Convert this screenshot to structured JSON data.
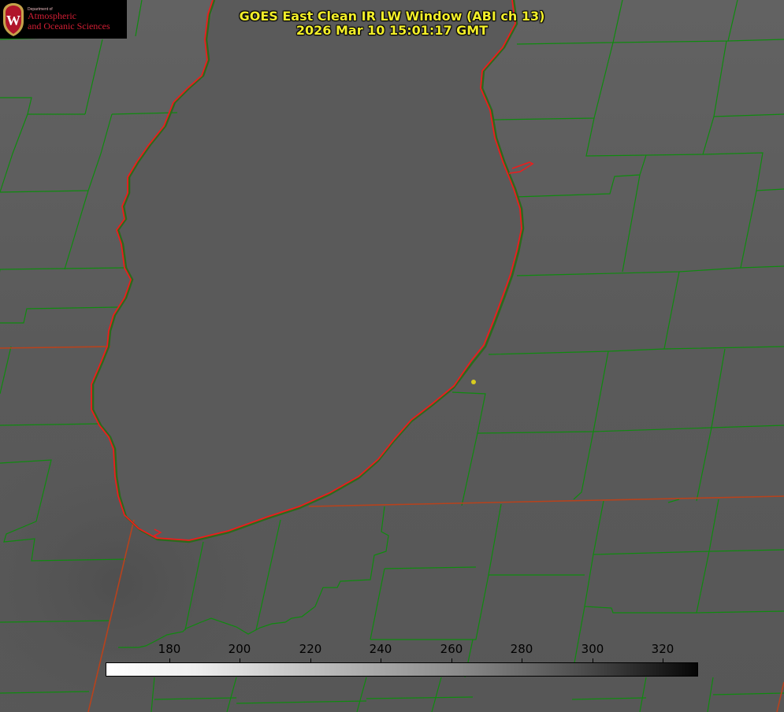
{
  "title": {
    "line1": "GOES East Clean IR LW Window (ABI ch 13)",
    "line2": "2026 Mar 10 15:01:17 GMT"
  },
  "logo": {
    "department": "Department of",
    "line1": "Atmospheric",
    "line2": "and Oceanic Sciences",
    "crest_letter": "W"
  },
  "colorbar": {
    "min": 162,
    "max": 330,
    "ticks": [
      "180",
      "200",
      "220",
      "240",
      "260",
      "280",
      "300",
      "320"
    ],
    "colormap": "white-to-black grayscale"
  },
  "colors": {
    "background": "#5c5c5c",
    "lake": "#595959",
    "county_lines": "#0f8a0f",
    "coastline": "#ee1c1c",
    "state_line": "#b8421c",
    "title_text": "#f2ee2a",
    "marker": "#d8cc1f",
    "logo_red": "#d21e34"
  },
  "map": {
    "projection": "satellite image",
    "features": [
      "county-boundaries",
      "state-boundaries",
      "lake-shoreline",
      "location-marker"
    ]
  }
}
